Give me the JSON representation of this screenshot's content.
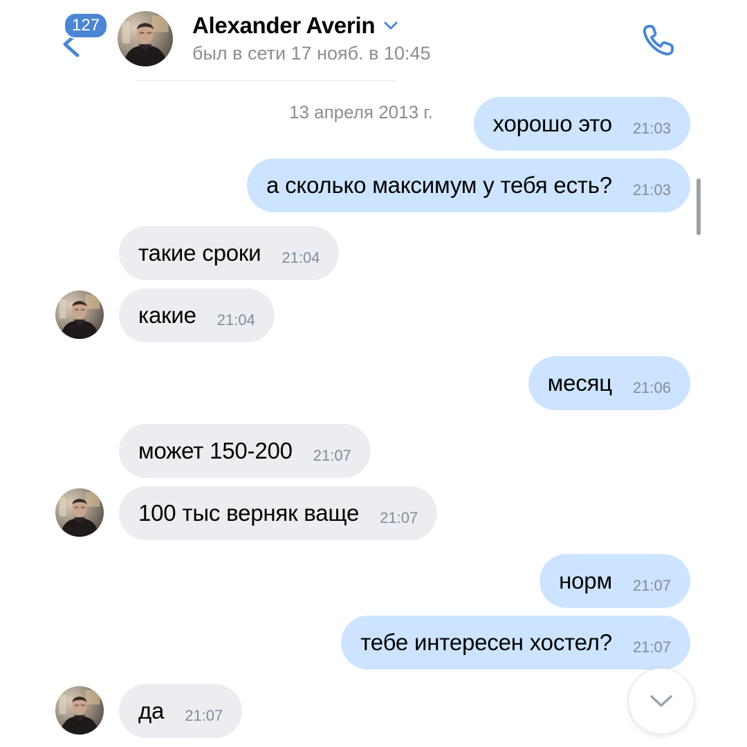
{
  "header": {
    "unread_count": "127",
    "contact_name": "Alexander Averin",
    "status": "был в сети 17 нояб. в 10:45"
  },
  "chat": {
    "date_separator": "13 апреля 2013 г.",
    "messages": [
      {
        "dir": "out",
        "text": "хорошо это",
        "time": "21:03"
      },
      {
        "dir": "out",
        "text": "а сколько максимум у тебя есть?",
        "time": "21:03"
      },
      {
        "dir": "in",
        "text": "такие сроки",
        "time": "21:04"
      },
      {
        "dir": "in",
        "text": "какие",
        "time": "21:04"
      },
      {
        "dir": "out",
        "text": "месяц",
        "time": "21:06"
      },
      {
        "dir": "in",
        "text": "может 150-200",
        "time": "21:07"
      },
      {
        "dir": "in",
        "text": "100 тыс верняк ваще",
        "time": "21:07"
      },
      {
        "dir": "out",
        "text": "норм",
        "time": "21:07"
      },
      {
        "dir": "out",
        "text": "тебе интересен хостел?",
        "time": "21:07"
      },
      {
        "dir": "in",
        "text": "да",
        "time": "21:07"
      }
    ]
  },
  "icons": {
    "back": "back-arrow-icon",
    "name_dropdown": "chevron-down-icon",
    "call": "phone-icon",
    "scroll_down": "chevron-down-icon"
  },
  "colors": {
    "accent": "#4a86d4",
    "outgoing_bubble": "#cce4ff",
    "incoming_bubble": "#ebedf0",
    "secondary_text": "#8a8d93"
  }
}
